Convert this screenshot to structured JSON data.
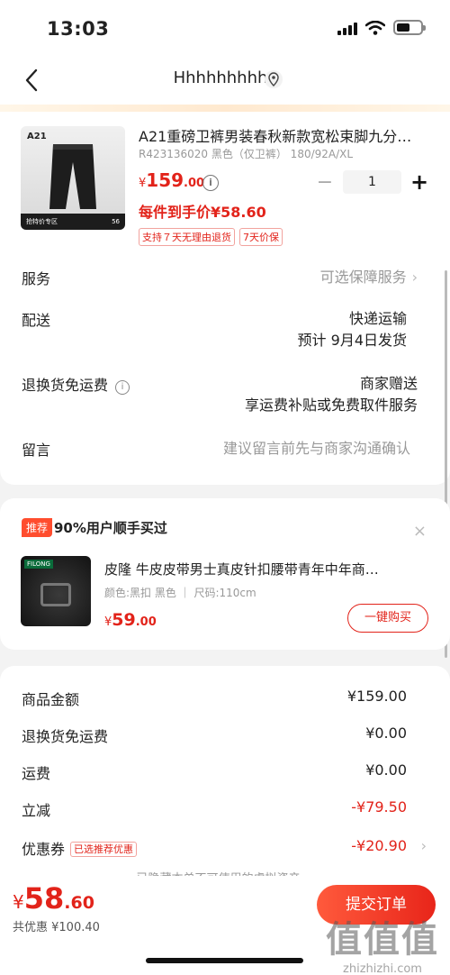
{
  "status_bar": {
    "time": "13:03",
    "battery_level": 0.55
  },
  "nav": {
    "title": "Hhhhhhhhh"
  },
  "product": {
    "image_brand": "A21",
    "image_banner_left": "抢特价专区",
    "image_banner_right": "56",
    "title": "A21重磅卫裤男装春秋新款宽松束脚九分…",
    "sku": "R423136020 黑色（仅卫裤） 180/92A/XL",
    "price": {
      "currency": "¥",
      "integer": "159",
      "decimal": ".00"
    },
    "info_icon": "i",
    "quantity": "1",
    "minus": "−",
    "plus": "+",
    "deal_price": "每件到手价¥58.60",
    "tags": [
      "支持７天无理由退货",
      "7天价保"
    ]
  },
  "details": {
    "service_label": "服务",
    "service_value": "可选保障服务",
    "delivery_label": "配送",
    "delivery_value1": "快递运输",
    "delivery_value2": "预计 9月4日发货",
    "return_label": "退换货免运费",
    "return_value1": "商家赠送",
    "return_value2": "享运费补贴或免费取件服务",
    "note_label": "留言",
    "note_placeholder": "建议留言前先与商家沟通确认",
    "chevron": "›"
  },
  "recommend": {
    "badge": "推荐",
    "title": "90%用户顺手买过",
    "close": "×",
    "image_logo": "FILONG",
    "name": "皮隆 牛皮皮带男士真皮针扣腰带青年中年商…",
    "sku": "颜色:黑扣 黑色 ｜ 尺码:110cm",
    "price": {
      "currency": "¥",
      "integer": "59",
      "decimal": ".00"
    },
    "buy_button": "一键购买"
  },
  "summary": {
    "goods_amount_label": "商品金额",
    "goods_amount": "¥159.00",
    "return_free_label": "退换货免运费",
    "return_free": "¥0.00",
    "shipping_label": "运费",
    "shipping": "¥0.00",
    "discount_label": "立减",
    "discount": "-¥79.50",
    "coupon_label": "优惠券",
    "coupon_tag": "已选推荐优惠",
    "coupon": "-¥20.90",
    "hidden_note": "已隐藏本单不可使用的虚拟资产 ⌄"
  },
  "bottom": {
    "total": {
      "currency": "¥",
      "integer": "58",
      "decimal": ".60"
    },
    "saved": "共优惠 ¥100.40",
    "submit": "提交订单"
  },
  "watermark": {
    "line1": "值值值",
    "line2": "zhizhizhi.com"
  },
  "colors": {
    "accent_red": "#e2231a",
    "badge_red": "#ff4d2e"
  }
}
